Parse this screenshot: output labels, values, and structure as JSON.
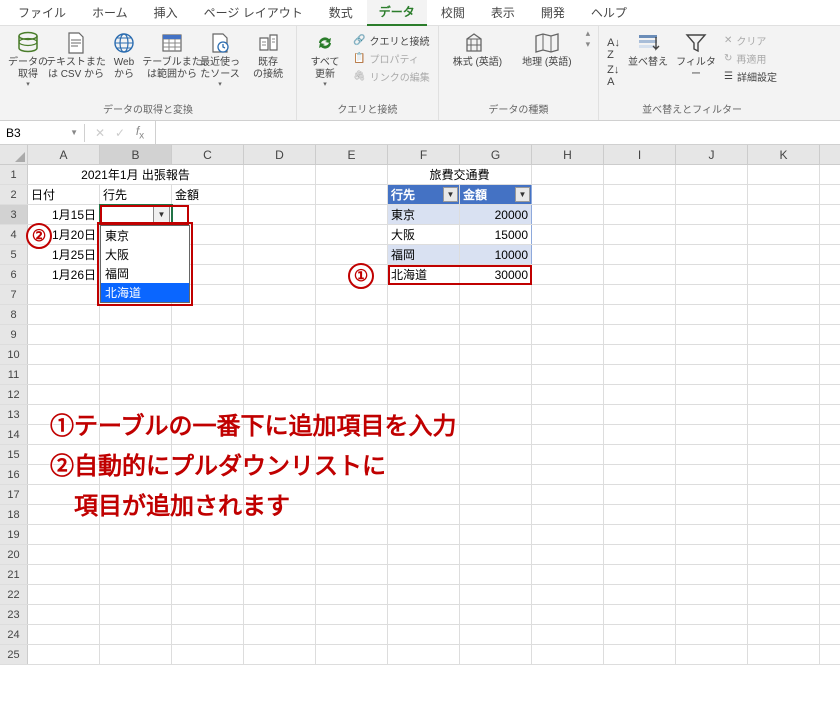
{
  "tabs": {
    "file": "ファイル",
    "home": "ホーム",
    "insert": "挿入",
    "pagelayout": "ページ レイアウト",
    "formulas": "数式",
    "data": "データ",
    "review": "校閲",
    "view": "表示",
    "dev": "開発",
    "help": "ヘルプ"
  },
  "ribbon": {
    "g_get": {
      "label": "データの取得と変換",
      "get_data": "データの\n取得",
      "text_csv": "テキストまた\nは CSV から",
      "web": "Web\nから",
      "table": "テーブルまた\nは範囲から",
      "recent": "最近使っ\nたソース",
      "existing": "既存\nの接続"
    },
    "g_qc": {
      "label": "クエリと接続",
      "refresh": "すべて\n更新",
      "qc": "クエリと接続",
      "prop": "プロパティ",
      "links": "リンクの編集"
    },
    "g_types": {
      "label": "データの種類",
      "stocks": "株式 (英語)",
      "geo": "地理 (英語)"
    },
    "g_sort": {
      "label": "並べ替えとフィルター",
      "az": "A↓Z",
      "za": "Z↓A",
      "sort": "並べ替え",
      "filter": "フィルター",
      "clear": "クリア",
      "reapply": "再適用",
      "adv": "詳細設定"
    }
  },
  "name_box": "B3",
  "columns": [
    "A",
    "B",
    "C",
    "D",
    "E",
    "F",
    "G",
    "H",
    "I",
    "J",
    "K"
  ],
  "sheet1": {
    "title": "2021年1月 出張報告",
    "hdr": {
      "date": "日付",
      "dest": "行先",
      "amount": "金額"
    },
    "rows": [
      {
        "date": "1月15日"
      },
      {
        "date": "1月20日"
      },
      {
        "date": "1月25日"
      },
      {
        "date": "1月26日"
      }
    ]
  },
  "table2": {
    "title": "旅費交通費",
    "hdr": {
      "dest": "行先",
      "amount": "金額"
    },
    "rows": [
      {
        "dest": "東京",
        "amount": "20000"
      },
      {
        "dest": "大阪",
        "amount": "15000"
      },
      {
        "dest": "福岡",
        "amount": "10000"
      },
      {
        "dest": "北海道",
        "amount": "30000"
      }
    ]
  },
  "dropdown": {
    "items": [
      "東京",
      "大阪",
      "福岡",
      "北海道"
    ],
    "highlight": 3
  },
  "annotation": {
    "num1": "①",
    "num2": "②",
    "line1": "①テーブルの一番下に追加項目を入力",
    "line2": "②自動的にプルダウンリストに",
    "line3": "　項目が追加されます"
  }
}
